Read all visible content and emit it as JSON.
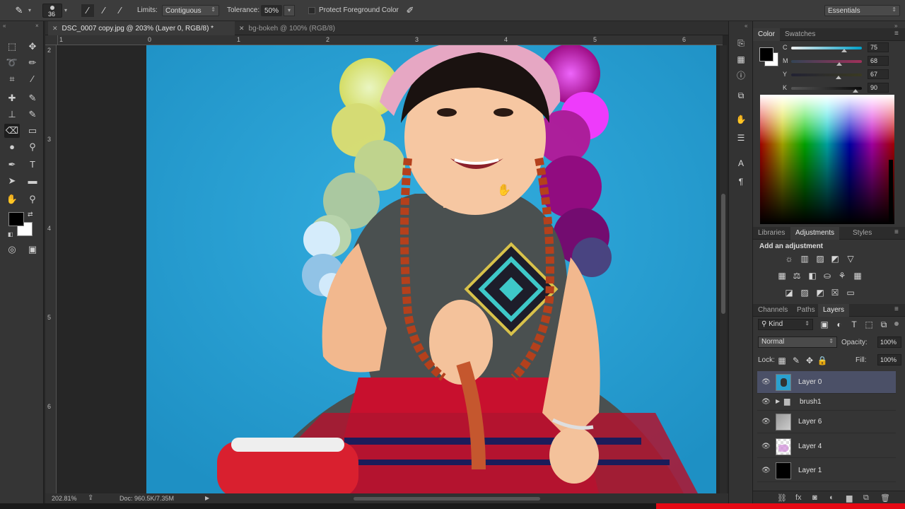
{
  "options_bar": {
    "brush_size": "36",
    "limits_label": "Limits:",
    "limits_value": "Contiguous",
    "tolerance_label": "Tolerance:",
    "tolerance_value": "50%",
    "protect_fg_label": "Protect Foreground Color",
    "workspace": "Essentials"
  },
  "tabs": [
    {
      "label": "DSC_0007 copy.jpg @ 203% (Layer 0, RGB/8) *"
    },
    {
      "label": "bg-bokeh @ 100% (RGB/8)"
    }
  ],
  "ruler": {
    "h_ticks": [
      "1",
      "0",
      "1",
      "2",
      "3",
      "4",
      "5",
      "6"
    ],
    "v_ticks": [
      "2",
      "3",
      "4",
      "5",
      "6"
    ]
  },
  "status_bar": {
    "zoom": "202.81%",
    "doc_size": "Doc: 960.5K/7.35M"
  },
  "color_panel": {
    "tabs": [
      "Color",
      "Swatches"
    ],
    "sliders": [
      {
        "label": "C",
        "value": "75",
        "level": 0.75
      },
      {
        "label": "M",
        "value": "68",
        "level": 0.68
      },
      {
        "label": "Y",
        "value": "67",
        "level": 0.67
      },
      {
        "label": "K",
        "value": "90",
        "level": 0.9
      }
    ]
  },
  "adjustments_panel": {
    "tabs": [
      "Libraries",
      "Adjustments",
      "Styles"
    ],
    "heading": "Add an adjustment"
  },
  "layers_panel": {
    "tabs": [
      "Channels",
      "Paths",
      "Layers"
    ],
    "filter_label": "Kind",
    "blend_mode": "Normal",
    "opacity_label": "Opacity:",
    "opacity_value": "100%",
    "lock_label": "Lock:",
    "fill_label": "Fill:",
    "fill_value": "100%",
    "layers": [
      {
        "name": "Layer 0",
        "selected": true
      },
      {
        "name": "brush1",
        "selected": false
      },
      {
        "name": "Layer 6",
        "selected": false
      },
      {
        "name": "Layer 4",
        "selected": false
      },
      {
        "name": "Layer 1",
        "selected": false
      }
    ]
  },
  "colors": {
    "foreground": "#000000",
    "background": "#ffffff",
    "selected_layer": "#4b5067",
    "photo_background": "#2aa0cf"
  }
}
